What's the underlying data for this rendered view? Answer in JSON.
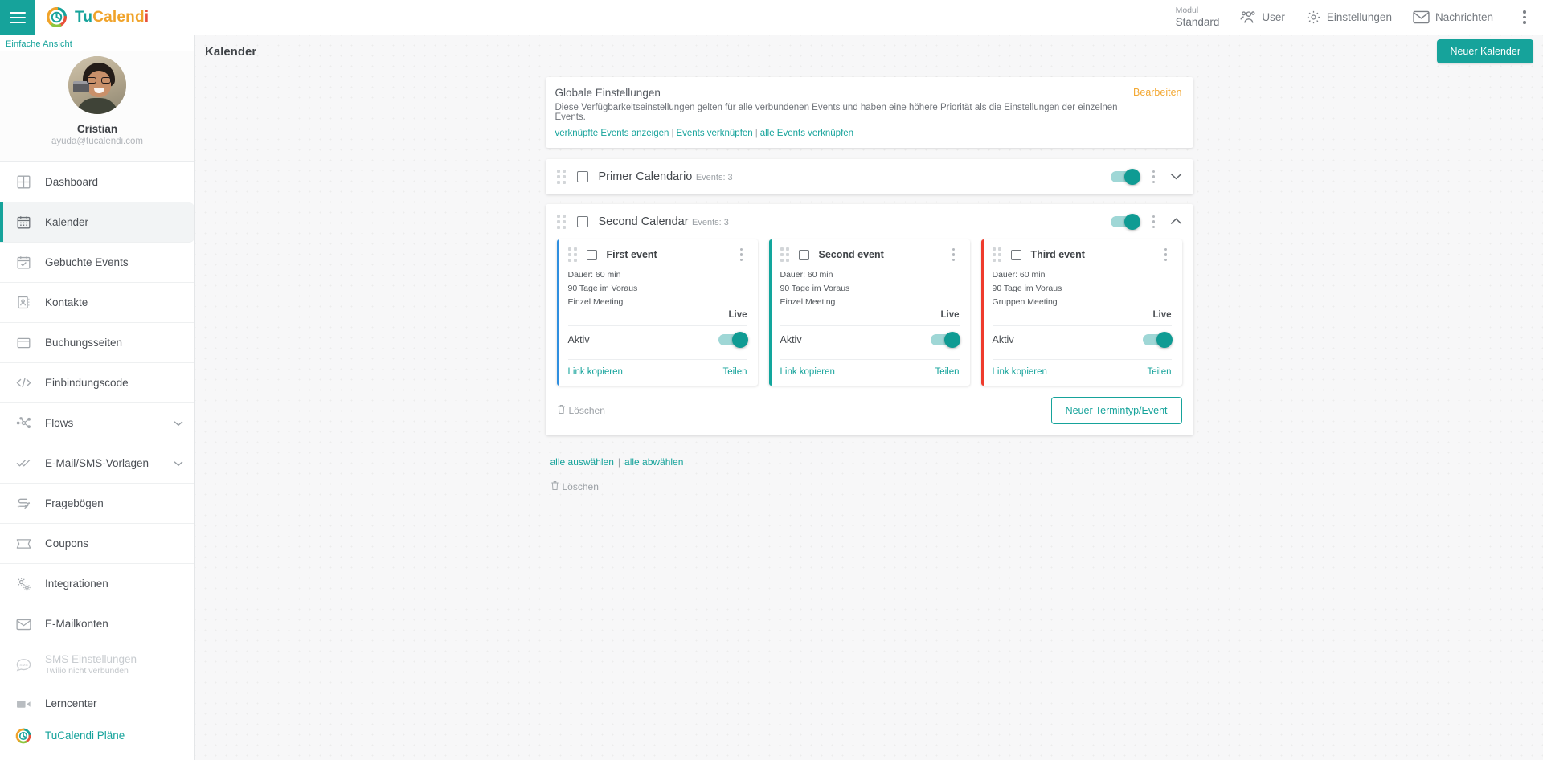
{
  "brand": {
    "part1": "Tu",
    "part2": "Calend",
    "part3": "i",
    "logo_icon": "tucalendi-logo-icon"
  },
  "topbar": {
    "menu_icon": "hamburger-menu-icon",
    "module_label": "Modul",
    "module_value": "Standard",
    "items": [
      {
        "label": "User",
        "icon": "users-icon"
      },
      {
        "label": "Einstellungen",
        "icon": "gear-icon"
      },
      {
        "label": "Nachrichten",
        "icon": "envelope-icon"
      }
    ],
    "overflow_icon": "kebab-menu-icon"
  },
  "sidebar": {
    "simple_view": "Einfache Ansicht",
    "profile": {
      "name": "Cristian",
      "email": "ayuda@tucalendi.com",
      "avatar": "user-avatar"
    },
    "items": [
      {
        "label": "Dashboard",
        "icon": "dashboard-grid-icon",
        "active": false
      },
      {
        "label": "Kalender",
        "icon": "calendar-icon",
        "active": true
      },
      {
        "label": "Gebuchte Events",
        "icon": "calendar-check-icon",
        "active": false
      },
      {
        "label": "Kontakte",
        "icon": "contacts-book-icon",
        "active": false
      },
      {
        "label": "Buchungsseiten",
        "icon": "browser-window-icon",
        "active": false
      },
      {
        "label": "Einbindungscode",
        "icon": "code-brackets-icon",
        "active": false
      },
      {
        "label": "Flows",
        "icon": "flow-nodes-icon",
        "active": false,
        "chevron": true
      },
      {
        "label": "E-Mail/SMS-Vorlagen",
        "icon": "double-check-icon",
        "active": false,
        "chevron": true
      },
      {
        "label": "Fragebögen",
        "icon": "survey-icon",
        "active": false
      },
      {
        "label": "Coupons",
        "icon": "ticket-icon",
        "active": false
      },
      {
        "label": "Integrationen",
        "icon": "gears-icon",
        "active": false
      },
      {
        "label": "E-Mailkonten",
        "icon": "envelope-icon",
        "active": false
      },
      {
        "label": "SMS Einstellungen",
        "sublabel": "Twilio nicht verbunden",
        "icon": "sms-bubble-icon",
        "active": false,
        "dim": true
      }
    ],
    "bottom_items": [
      {
        "label": "Lerncenter",
        "icon": "video-camera-icon"
      },
      {
        "label": "TuCalendi Pläne",
        "icon": "tucalendi-logo-icon"
      }
    ]
  },
  "main": {
    "page_title": "Kalender",
    "new_calendar_button": "Neuer Kalender",
    "global_settings": {
      "title": "Globale Einstellungen",
      "description": "Diese Verfügbarkeitseinstellungen gelten für alle verbundenen Events und haben eine höhere Priorität als die Einstellungen der einzelnen Events.",
      "links": [
        "verknüpfte Events anzeigen",
        "Events verknüpfen",
        "alle Events verknüpfen"
      ],
      "separator": "|",
      "edit_label": "Bearbeiten"
    },
    "calendars": [
      {
        "name": "Primer Calendario",
        "events_label": "Events: 3",
        "enabled": true,
        "expanded": false,
        "chevron_icon": "chevron-down-icon"
      },
      {
        "name": "Second Calendar",
        "events_label": "Events: 3",
        "enabled": true,
        "expanded": true,
        "chevron_icon": "chevron-up-icon",
        "events": [
          {
            "name": "First event",
            "duration": "Dauer: 60 min",
            "advance": "90 Tage im Voraus",
            "type": "Einzel Meeting",
            "status": "Live",
            "active_label": "Aktiv",
            "active": true,
            "copy_link": "Link kopieren",
            "share": "Teilen",
            "accent": "#2f8fe0"
          },
          {
            "name": "Second event",
            "duration": "Dauer: 60 min",
            "advance": "90 Tage im Voraus",
            "type": "Einzel Meeting",
            "status": "Live",
            "active_label": "Aktiv",
            "active": true,
            "copy_link": "Link kopieren",
            "share": "Teilen",
            "accent": "#12a69d"
          },
          {
            "name": "Third event",
            "duration": "Dauer: 60 min",
            "advance": "90 Tage im Voraus",
            "type": "Gruppen Meeting",
            "status": "Live",
            "active_label": "Aktiv",
            "active": true,
            "copy_link": "Link kopieren",
            "share": "Teilen",
            "accent": "#ef3b2d"
          }
        ],
        "footer": {
          "delete_label": "Löschen",
          "delete_icon": "trash-icon",
          "new_event_button": "Neuer Termintyp/Event"
        }
      }
    ],
    "bulk": {
      "select_all": "alle auswählen",
      "separator": "|",
      "deselect_all": "alle abwählen",
      "delete_label": "Löschen",
      "delete_icon": "trash-icon"
    }
  },
  "colors": {
    "accent": "#16a39b",
    "orange": "#f3a833",
    "red": "#e8503a",
    "blue": "#2f8fe0"
  }
}
